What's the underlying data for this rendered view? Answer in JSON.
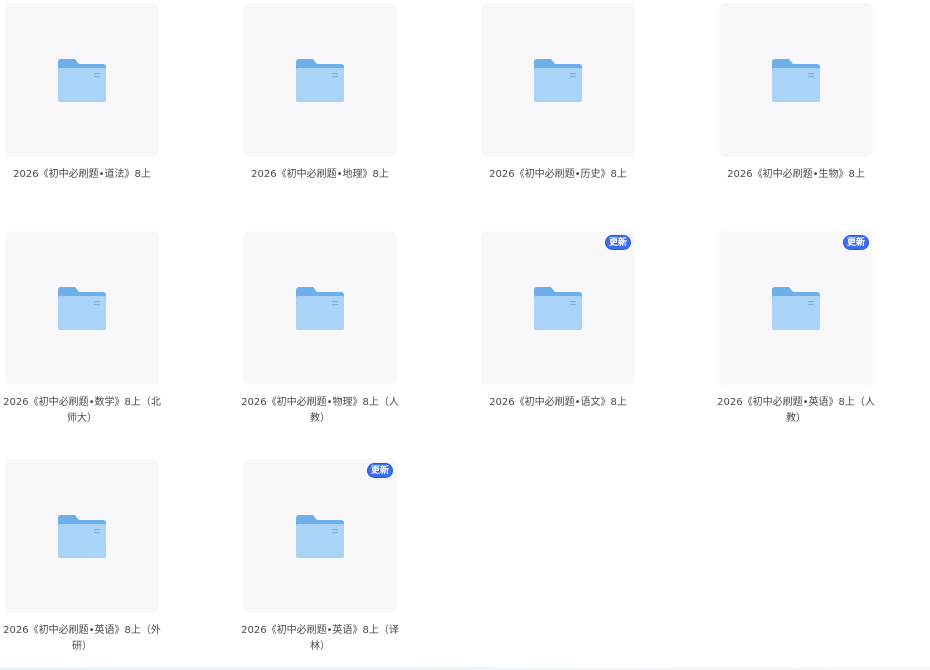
{
  "folders": [
    {
      "name": "2026《初中必刷题•道法》8上",
      "badge": ""
    },
    {
      "name": "2026《初中必刷题•地理》8上",
      "badge": ""
    },
    {
      "name": "2026《初中必刷题•历史》8上",
      "badge": ""
    },
    {
      "name": "2026《初中必刷题•生物》8上",
      "badge": ""
    },
    {
      "name": "2026《初中必刷题•数学》8上（北师大）",
      "badge": ""
    },
    {
      "name": "2026《初中必刷题•物理》8上（人教）",
      "badge": ""
    },
    {
      "name": "2026《初中必刷题•语文》8上",
      "badge": "更新"
    },
    {
      "name": "2026《初中必刷题•英语》8上（人教）",
      "badge": "更新"
    },
    {
      "name": "2026《初中必刷题•英语》8上（外研）",
      "badge": ""
    },
    {
      "name": "2026《初中必刷题•英语》8上（译林）",
      "badge": "更新"
    }
  ],
  "icons": {
    "folder": "folder-icon"
  },
  "colors": {
    "folder_back": "#6fb0ea",
    "folder_front": "#a9d3f7",
    "badge": "#3d6ef0",
    "tile_bg": "#f8f8fa"
  }
}
